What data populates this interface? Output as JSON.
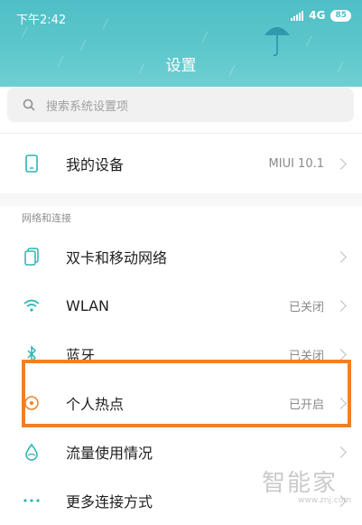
{
  "status_bar": {
    "time": "下午2:42",
    "network": "4G",
    "battery": "85"
  },
  "header": {
    "title": "设置"
  },
  "search": {
    "placeholder": "搜索系统设置项"
  },
  "device": {
    "label": "我的设备",
    "value": "MIUI 10.1",
    "icon": "phone-icon"
  },
  "network_section": {
    "title": "网络和连接",
    "items": [
      {
        "label": "双卡和移动网络",
        "value": "",
        "icon": "sim-icon"
      },
      {
        "label": "WLAN",
        "value": "已关闭",
        "icon": "wifi-icon"
      },
      {
        "label": "蓝牙",
        "value": "已关闭",
        "icon": "bluetooth-icon"
      },
      {
        "label": "个人热点",
        "value": "已开启",
        "icon": "hotspot-icon"
      },
      {
        "label": "流量使用情况",
        "value": "",
        "icon": "data-drop-icon"
      },
      {
        "label": "更多连接方式",
        "value": "",
        "icon": "more-dots-icon"
      }
    ]
  },
  "highlight_color": "#f08027",
  "accent_color": "#2ab5b2",
  "watermark": {
    "text": "智能家",
    "url": "www.znj.com"
  }
}
